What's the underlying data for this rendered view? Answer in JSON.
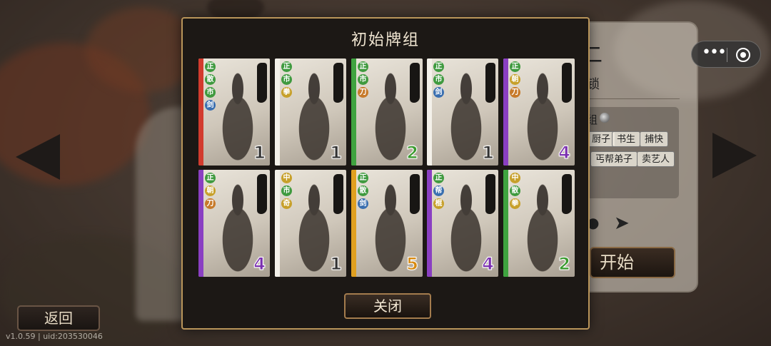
{
  "modal": {
    "title": "初始牌组",
    "close_label": "关闭",
    "cards": [
      {
        "badges": [
          "正",
          "散",
          "市",
          "剑"
        ],
        "badge_colors": [
          "#3f9a3f",
          "#3f9a3f",
          "#3f9a3f",
          "#3a6fb0"
        ],
        "stripe": "#d23b2e",
        "cost": "1",
        "cost_color": "#333333"
      },
      {
        "badges": [
          "正",
          "市",
          "拳"
        ],
        "badge_colors": [
          "#3f9a3f",
          "#3f9a3f",
          "#c7a02a"
        ],
        "stripe": "#f4f1ea",
        "cost": "1",
        "cost_color": "#333333"
      },
      {
        "badges": [
          "正",
          "市",
          "刀"
        ],
        "badge_colors": [
          "#3f9a3f",
          "#3f9a3f",
          "#c77a2a"
        ],
        "stripe": "#3fa33f",
        "cost": "2",
        "cost_color": "#3a9a2e"
      },
      {
        "badges": [
          "正",
          "市",
          "剑"
        ],
        "badge_colors": [
          "#3f9a3f",
          "#3f9a3f",
          "#3a6fb0"
        ],
        "stripe": "#f4f1ea",
        "cost": "1",
        "cost_color": "#333333"
      },
      {
        "badges": [
          "正",
          "朝",
          "刀"
        ],
        "badge_colors": [
          "#3f9a3f",
          "#c7a02a",
          "#c77a2a"
        ],
        "stripe": "#8a3fc2",
        "cost": "4",
        "cost_color": "#7a2fb0"
      },
      {
        "badges": [
          "正",
          "朝",
          "刀"
        ],
        "badge_colors": [
          "#3f9a3f",
          "#c7a02a",
          "#c77a2a"
        ],
        "stripe": "#8a3fc2",
        "cost": "4",
        "cost_color": "#7a2fb0"
      },
      {
        "badges": [
          "中",
          "市",
          "奇"
        ],
        "badge_colors": [
          "#c7a02a",
          "#3f9a3f",
          "#c7a02a"
        ],
        "stripe": "#f4f1ea",
        "cost": "1",
        "cost_color": "#333333"
      },
      {
        "badges": [
          "正",
          "散",
          "剑"
        ],
        "badge_colors": [
          "#3f9a3f",
          "#3f9a3f",
          "#3a6fb0"
        ],
        "stripe": "#e0a020",
        "cost": "5",
        "cost_color": "#d88a10"
      },
      {
        "badges": [
          "正",
          "帮",
          "棍"
        ],
        "badge_colors": [
          "#3f9a3f",
          "#3a6fb0",
          "#c7a02a"
        ],
        "stripe": "#8a3fc2",
        "cost": "4",
        "cost_color": "#7a2fb0"
      },
      {
        "badges": [
          "中",
          "散",
          "拳"
        ],
        "badge_colors": [
          "#c7a02a",
          "#3f9a3f",
          "#c7a02a"
        ],
        "stripe": "#3fa33f",
        "cost": "2",
        "cost_color": "#3a9a2e"
      }
    ]
  },
  "info_panel": {
    "title": "店小二",
    "subtitle": "锁",
    "section_label": "组",
    "tags": [
      "厨子",
      "书生",
      "捕快",
      "丐帮弟子",
      "卖艺人"
    ],
    "start_label": "开始"
  },
  "footer": {
    "back_label": "返回",
    "version": "v1.0.59 | uid:203530046"
  },
  "icons": {
    "prev": "chevron-left-icon",
    "next": "chevron-right-icon",
    "capsule_more": "more-dots-icon",
    "capsule_close": "target-close-icon"
  }
}
